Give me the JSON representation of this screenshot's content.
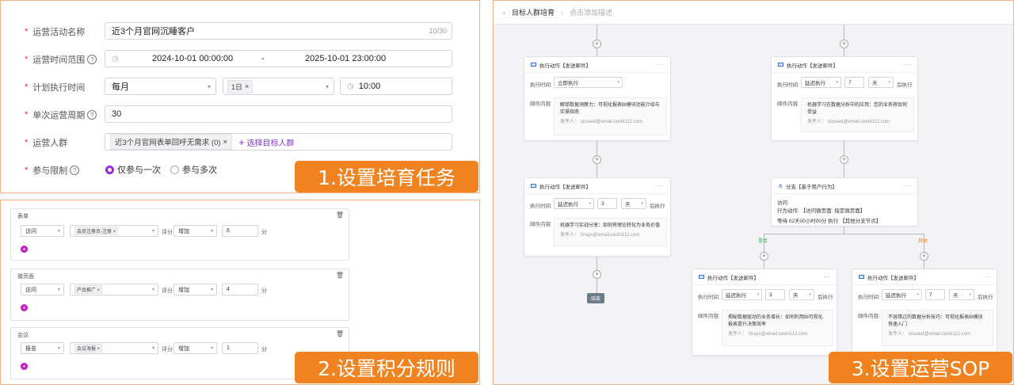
{
  "task": {
    "name_label": "运营活动名称",
    "name_value": "近3个月官网沉睡客户",
    "name_count": "10/30",
    "time_label": "运营时间范围",
    "time_start": "2024-10-01 00:00:00",
    "time_sep": "-",
    "time_end": "2025-10-01 23:00:00",
    "plan_label": "计划执行时间",
    "plan_freq": "每月",
    "plan_day": "1日",
    "plan_time": "10:00",
    "cycle_label": "单次运营周期",
    "cycle_value": "30",
    "crowd_label": "运营人群",
    "crowd_tag": "近3个月官网表单回呼无需求 (0)",
    "crowd_add": "选择目标人群",
    "limit_label": "参与限制",
    "limit_once": "仅参与一次",
    "limit_multi": "参与多次"
  },
  "callouts": {
    "c1": "1.设置培育任务",
    "c2": "2.设置积分规则",
    "c3": "3.设置运营SOP"
  },
  "rules": [
    {
      "title": "表单",
      "action": "访问",
      "target": "会员注册页-注册",
      "score_label": "评分",
      "op": "增加",
      "value": "6",
      "unit": "分"
    },
    {
      "title": "微页面",
      "action": "访问",
      "target": "产品推广",
      "score_label": "评分",
      "op": "增加",
      "value": "4",
      "unit": "分"
    },
    {
      "title": "会议",
      "action": "报名",
      "target": "会议海报",
      "score_label": "评分",
      "op": "增加",
      "value": "1",
      "unit": "分"
    }
  ],
  "sop": {
    "breadcrumb": "目标人群培育",
    "desc_hint": "点击添加描述",
    "exec_time_label": "执行时间:",
    "content_label": "邮件内容:",
    "after_exec": "后执行",
    "end": "结束",
    "cards": [
      {
        "title": "执行动作【发送邮件】",
        "mode": "立即执行",
        "num": "",
        "unit": "",
        "subject": "解锁数据洞察力：可视化报表BI模块功能介绍与实操指南",
        "sender": "发件人： unused@email.ceshi112.com"
      },
      {
        "title": "执行动作【发送邮件】",
        "mode": "延迟执行",
        "num": "3",
        "unit": "天",
        "subject": "机器学习实战分享：如何将理论转化为业务价值",
        "sender": "发件人： Grays@email.ceshi112.com"
      },
      {
        "title": "执行动作【发送邮件】",
        "mode": "延迟执行",
        "num": "7",
        "unit": "天",
        "subject": "机器学习在数据分析中的应用：您的业务将如何受益",
        "sender": "发件人： unused@email.ceshi112.com"
      },
      {
        "title": "执行动作【发送邮件】",
        "mode": "延迟执行",
        "num": "3",
        "unit": "天",
        "subject": "揭秘数据驱动的业务增长：如何利用BI可视化报表提升决策效率",
        "sender": "发件人： Grays@email.ceshi112.com"
      },
      {
        "title": "执行动作【发送邮件】",
        "mode": "延迟执行",
        "num": "7",
        "unit": "天",
        "subject": "不容错过的数据分析技巧：可视化报表BI模块快速入门",
        "sender": "发件人： unused@email.ceshi112.com"
      }
    ],
    "branch": {
      "title": "分支【基于用户行为】",
      "line1": "访问:",
      "line2": "行为动作: 【访问微页面: 指定微页面】",
      "line3": "等待 02天00小时00分 执行 【其他分支节点】",
      "yes": "是否",
      "no": "其他"
    }
  }
}
